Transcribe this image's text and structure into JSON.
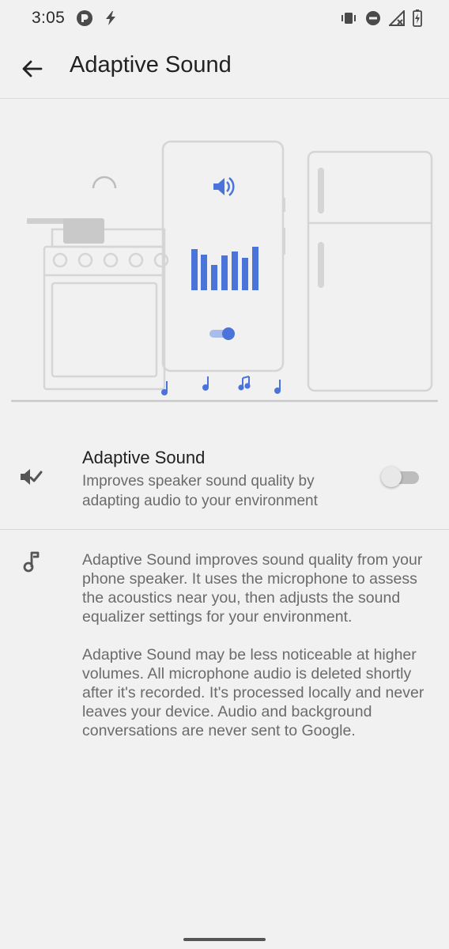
{
  "status_bar": {
    "time": "3:05",
    "left_icons": [
      "pandora-icon",
      "bolt-icon"
    ],
    "right_icons": [
      "vibrate-icon",
      "do-not-disturb-icon",
      "no-signal-icon",
      "battery-charging-icon"
    ]
  },
  "app_bar": {
    "back_icon": "arrow-back-icon",
    "title": "Adaptive Sound"
  },
  "setting": {
    "icon": "speaker-check-icon",
    "title": "Adaptive Sound",
    "subtitle": "Improves speaker sound quality by adapting audio to your environment",
    "enabled": false
  },
  "info": {
    "icon": "music-note-icon",
    "paragraph1": "Adaptive Sound improves sound quality from your phone speaker. It uses the microphone to assess the acoustics near you, then adjusts the sound equalizer settings for your environment.",
    "paragraph2": "Adaptive Sound may be less noticeable at higher volumes. All microphone audio is deleted shortly after it's recorded. It's processed locally and never leaves your device. Audio and background conversations are never sent to Google."
  },
  "colors": {
    "background": "#f1f1f1",
    "accent_blue": "#4a74d9",
    "illustration_line": "#d5d5d5",
    "secondary_text": "#6b6b6b"
  }
}
